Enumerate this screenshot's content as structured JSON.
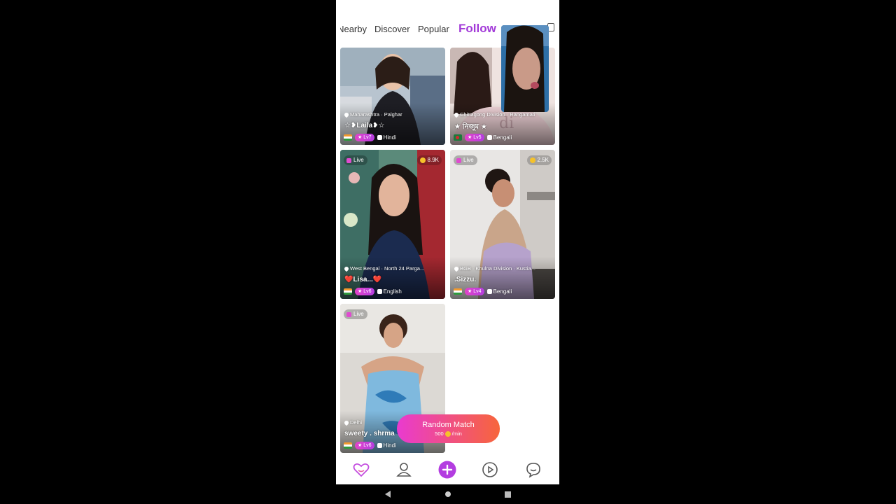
{
  "tabs": {
    "nearby": "Nearby",
    "discover": "Discover",
    "popular": "Popular",
    "follow": "Follow"
  },
  "cards": [
    {
      "location": "Maharashtra · Palghar",
      "name": "☆❥Laila❥☆",
      "level": "Lv7",
      "language": "Hindi",
      "flag": "india-flag-icon"
    },
    {
      "location": "Chittagong Division · Rangamati",
      "name": "★ নিজুম ★",
      "level": "Lv5",
      "language": "Bengali",
      "flag": "bangladesh-flag-icon"
    },
    {
      "live": "Live",
      "coins": "8.9K",
      "location": "West Bengal · North 24 Parga...",
      "name": "❤️Lisa...❤️",
      "level": "Lv6",
      "language": "English",
      "flag": "india-flag-icon"
    },
    {
      "live": "Live",
      "coins": "2.5K",
      "location": "BGB · Khulna Division · Kustia...",
      "name": ".Sizzu.",
      "level": "Lv4",
      "language": "Bengali",
      "flag": "india-flag-icon"
    },
    {
      "live": "Live",
      "location": "Delhi",
      "name": "sweety . shrma",
      "level": "Lv6",
      "language": "Hindi",
      "flag": "india-flag-icon"
    }
  ],
  "random_match": {
    "title": "Random Match",
    "price": "500",
    "unit": "/min"
  },
  "bottom_nav": [
    "heart-icon",
    "friends-icon",
    "plus-icon",
    "video-play-icon",
    "chat-icon"
  ],
  "colors": {
    "accent": "#a23ad8",
    "match_start": "#e93ad0",
    "match_end": "#f7653b"
  }
}
